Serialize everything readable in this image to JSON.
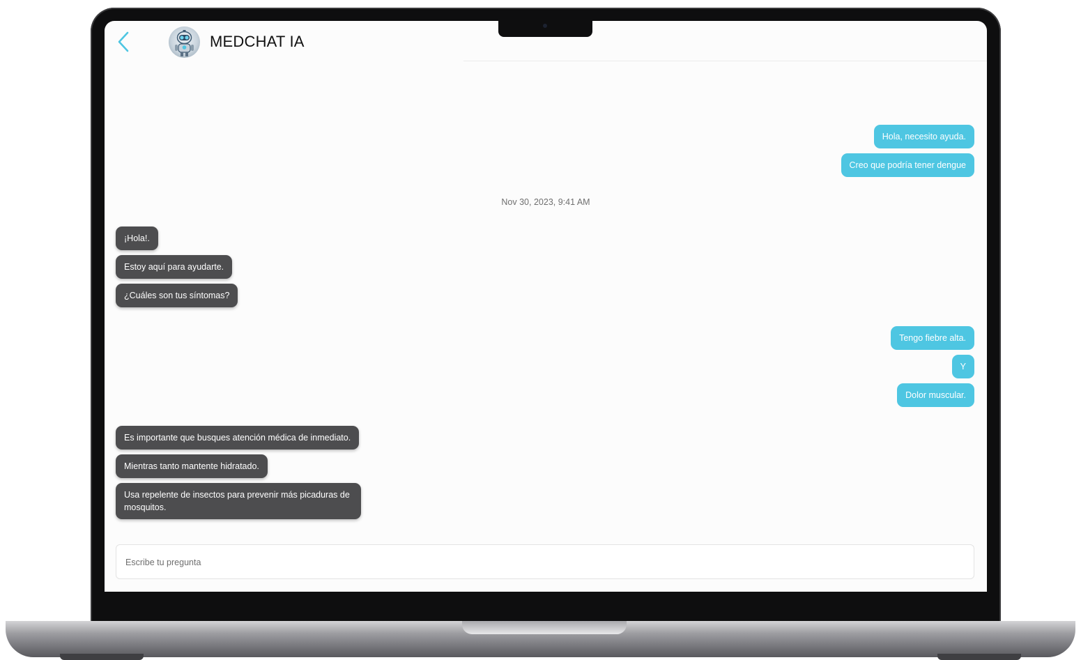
{
  "header": {
    "title": "MEDCHAT IA",
    "back_icon": "chevron-left-icon",
    "avatar_icon": "robot-avatar-icon",
    "accent_color": "#4ec6e2"
  },
  "chat": {
    "timestamp": "Nov 30, 2023, 9:41 AM",
    "messages": [
      {
        "from": "user",
        "text": "Hola, necesito ayuda."
      },
      {
        "from": "user",
        "text": "Creo que podría tener dengue"
      },
      {
        "from": "bot",
        "text": "¡Hola!."
      },
      {
        "from": "bot",
        "text": "Estoy aquí para ayudarte."
      },
      {
        "from": "bot",
        "text": "¿Cuáles son tus síntomas?"
      },
      {
        "from": "user",
        "text": "Tengo fiebre alta."
      },
      {
        "from": "user",
        "text": "Y"
      },
      {
        "from": "user",
        "text": "Dolor muscular."
      },
      {
        "from": "bot",
        "text": "Es importante que busques atención médica de inmediato."
      },
      {
        "from": "bot",
        "text": "Mientras tanto mantente hidratado."
      },
      {
        "from": "bot",
        "text": "Usa repelente de insectos para prevenir más picaduras de mosquitos."
      }
    ],
    "colors": {
      "user_bubble": "#4ec6e2",
      "bot_bubble": "#4d4d4f"
    }
  },
  "composer": {
    "placeholder": "Escribe tu pregunta",
    "value": ""
  }
}
